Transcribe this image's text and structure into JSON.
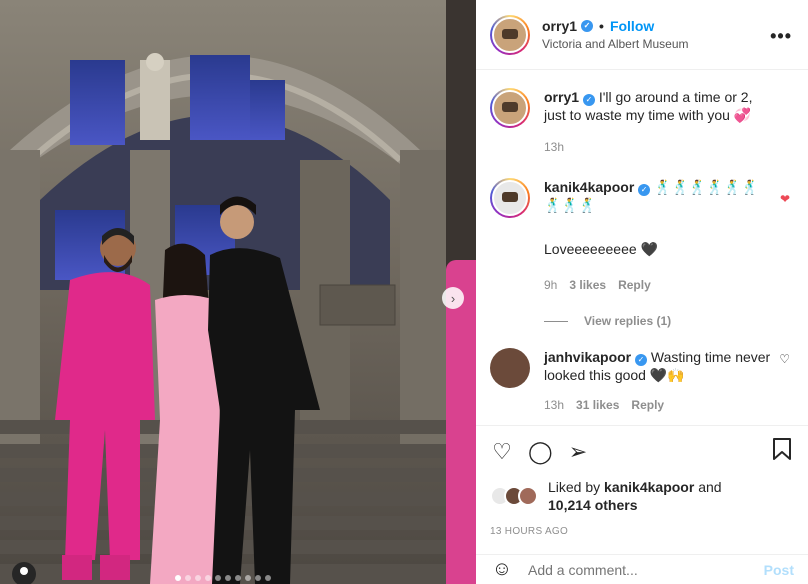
{
  "post": {
    "username": "orry1",
    "follow_label": "Follow",
    "separator": "•",
    "location": "Victoria and Albert Museum",
    "more_label": "•••"
  },
  "caption": {
    "username": "orry1",
    "text": "I'll go around a time or 2, just to waste my time with you 💞",
    "time": "13h"
  },
  "comments": [
    {
      "username": "kanik4kapoor",
      "text": "🕺🕺🕺🕺🕺🕺🕺🕺🕺",
      "text2": "Loveeeeeeeee 🖤",
      "time": "9h",
      "likes": "3 likes",
      "reply": "Reply",
      "view_replies": "View replies (1)",
      "liked_icon": "heart-filled-icon"
    },
    {
      "username": "janhvikapoor",
      "text": "Wasting time never looked this good 🖤🙌",
      "time": "13h",
      "likes": "31 likes",
      "reply": "Reply"
    }
  ],
  "actions": {
    "like_icon": "♡",
    "comment_icon": "◯",
    "share_icon": "➢",
    "save_icon": "🔖"
  },
  "liked_by": {
    "prefix": "Liked by",
    "user": "kanik4kapoor",
    "and": "and",
    "count": "10,214 others"
  },
  "timestamp": "13 HOURS AGO",
  "add_comment": {
    "emoji": "☺",
    "placeholder": "Add a comment...",
    "post_label": "Post"
  },
  "carousel": {
    "slides": 10,
    "active": 1,
    "next_icon": "›"
  },
  "colors": {
    "accent": "#0095f6",
    "heart": "#ed4956"
  }
}
